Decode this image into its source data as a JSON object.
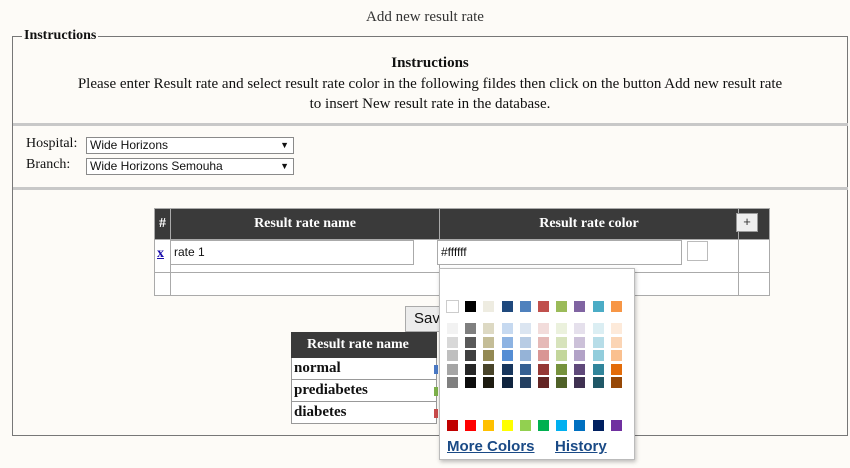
{
  "page": {
    "title": "Add new result rate"
  },
  "instructions": {
    "legend": "Instructions",
    "heading": "Instructions",
    "line1": "Please enter Result rate and select result rate color in the following fildes then click on the button Add new result rate",
    "line2": "to insert New result rate in the database."
  },
  "filters": {
    "hospital_label": "Hospital:",
    "hospital_value": "Wide Horizons",
    "branch_label": "Branch:",
    "branch_value": "Wide Horizons Semouha"
  },
  "rate_table": {
    "headers": [
      "#",
      "Result rate name",
      "Result rate color"
    ],
    "add_label": "+",
    "rows": [
      {
        "remove": "x",
        "name": "rate 1",
        "color": "#ffffff"
      }
    ]
  },
  "save_label": "Sav",
  "results": {
    "header": "Result rate name",
    "rows": [
      "normal",
      "prediabetes",
      "diabetes"
    ],
    "row_colors": [
      "#4a79c4",
      "#7db04a",
      "#c94a4a"
    ]
  },
  "picker": {
    "more_colors": "More Colors",
    "history": "History",
    "theme_colors": [
      "#ffffff",
      "#000000",
      "#eeece1",
      "#1f497d",
      "#4f81bd",
      "#c0504d",
      "#9bbb59",
      "#8064a2",
      "#4bacc6",
      "#f79646"
    ],
    "shades": [
      [
        "#f2f2f2",
        "#7f7f7f",
        "#ddd9c3",
        "#c6d9f0",
        "#dbe5f1",
        "#f2dcdb",
        "#ebf1dd",
        "#e5e0ec",
        "#dbeef3",
        "#fdeada"
      ],
      [
        "#d8d8d8",
        "#595959",
        "#c4bd97",
        "#8db3e2",
        "#b8cce4",
        "#e5b9b7",
        "#d7e3bc",
        "#ccc1d9",
        "#b7dde8",
        "#fbd5b5"
      ],
      [
        "#bfbfbf",
        "#3f3f3f",
        "#938953",
        "#548dd4",
        "#95b3d7",
        "#d99694",
        "#c3d69b",
        "#b2a2c7",
        "#92cddc",
        "#fac08f"
      ],
      [
        "#a5a5a5",
        "#262626",
        "#494429",
        "#17365d",
        "#366092",
        "#953734",
        "#76923c",
        "#5f497a",
        "#31859b",
        "#e36c09"
      ],
      [
        "#7f7f7f",
        "#0c0c0c",
        "#1d1b10",
        "#0f243e",
        "#244061",
        "#632423",
        "#4f6128",
        "#3f3151",
        "#205867",
        "#974806"
      ]
    ],
    "standard_colors": [
      "#c00000",
      "#ff0000",
      "#ffc000",
      "#ffff00",
      "#92d050",
      "#00b050",
      "#00b0f0",
      "#0070c0",
      "#002060",
      "#7030a0"
    ]
  }
}
